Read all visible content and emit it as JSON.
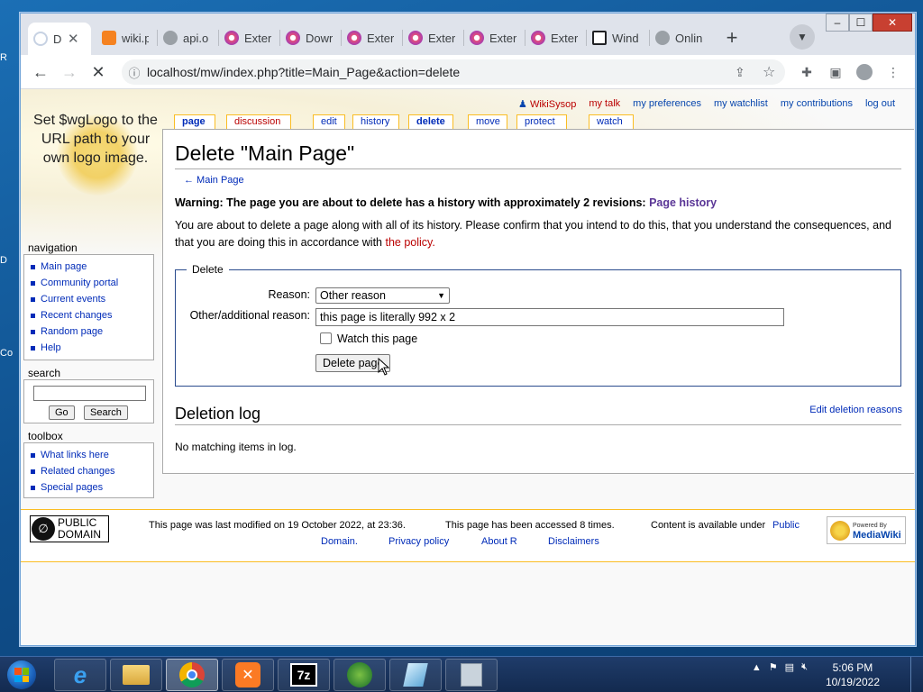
{
  "desktop": {
    "left_labels": [
      "R",
      "D",
      "Co"
    ]
  },
  "browser": {
    "tabs": [
      {
        "title": "D",
        "active": true,
        "favicon_color": "#e8eaed"
      },
      {
        "title": "wiki.p",
        "favicon_color": "#f58220"
      },
      {
        "title": "api.o",
        "favicon_color": "#9aa0a6"
      },
      {
        "title": "Exter",
        "favicon_color": "#e34f7a"
      },
      {
        "title": "Dowr",
        "favicon_color": "#e34f7a"
      },
      {
        "title": "Exter",
        "favicon_color": "#e34f7a"
      },
      {
        "title": "Exter",
        "favicon_color": "#e34f7a"
      },
      {
        "title": "Exter",
        "favicon_color": "#e34f7a"
      },
      {
        "title": "Exter",
        "favicon_color": "#e34f7a"
      },
      {
        "title": "Wind",
        "favicon_color": "#202124"
      },
      {
        "title": "Onlin",
        "favicon_color": "#9aa0a6"
      }
    ],
    "new_tab_label": "+",
    "url": "localhost/mw/index.php?title=Main_Page&action=delete",
    "window_controls": {
      "minimize": "–",
      "maximize": "☐",
      "close": "✕"
    }
  },
  "wiki": {
    "logo_text": "Set $wgLogo to the URL path to your own logo image.",
    "personal": [
      {
        "label": "WikiSysop",
        "red": true
      },
      {
        "label": "my talk",
        "red": true
      },
      {
        "label": "my preferences"
      },
      {
        "label": "my watchlist"
      },
      {
        "label": "my contributions"
      },
      {
        "label": "log out"
      }
    ],
    "page_tabs": [
      {
        "label": "page",
        "selected": true
      },
      {
        "label": "discussion",
        "red": true
      },
      {
        "label": "edit"
      },
      {
        "label": "history"
      },
      {
        "label": "delete",
        "selected": true
      },
      {
        "label": "move"
      },
      {
        "label": "protect"
      },
      {
        "label": "watch"
      }
    ],
    "title": "Delete \"Main Page\"",
    "back_link": "← Main Page",
    "warning": "Warning: The page you are about to delete has a history with approximately 2 revisions:",
    "warning_link": "Page history",
    "intro": "You are about to delete a page along with all of its history. Please confirm that you intend to do this, that you understand the consequences, and that you are doing this in accordance with",
    "intro_link": "the policy.",
    "form": {
      "legend": "Delete",
      "reason_label": "Reason:",
      "reason_value": "Other reason",
      "other_label": "Other/additional reason:",
      "other_value": "this page is literally 992 x 2",
      "watch_label": "Watch this page",
      "submit_label": "Delete page"
    },
    "deletion_log_heading": "Deletion log",
    "edit_deletion_reasons": "Edit deletion reasons",
    "no_log": "No matching items in log.",
    "navigation": {
      "heading": "navigation",
      "items": [
        "Main page",
        "Community portal",
        "Current events",
        "Recent changes",
        "Random page",
        "Help"
      ]
    },
    "search": {
      "heading": "search",
      "go_label": "Go",
      "search_label": "Search"
    },
    "toolbox": {
      "heading": "toolbox",
      "items": [
        "What links here",
        "Related changes",
        "Special pages"
      ]
    },
    "footer": {
      "pd_line1": "PUBLIC",
      "pd_line2": "DOMAIN",
      "last_modified": "This page was last modified on 19 October 2022, at 23:36.",
      "accessed": "This page has been accessed 8 times.",
      "content_available": "Content is available under",
      "license_link_a": "Public",
      "license_link_b": "Domain.",
      "privacy": "Privacy policy",
      "about": "About R",
      "disclaimers": "Disclaimers",
      "powered_by": "Powered By",
      "mediawiki": "MediaWiki"
    }
  },
  "taskbar": {
    "time": "5:06 PM",
    "date": "10/19/2022"
  }
}
